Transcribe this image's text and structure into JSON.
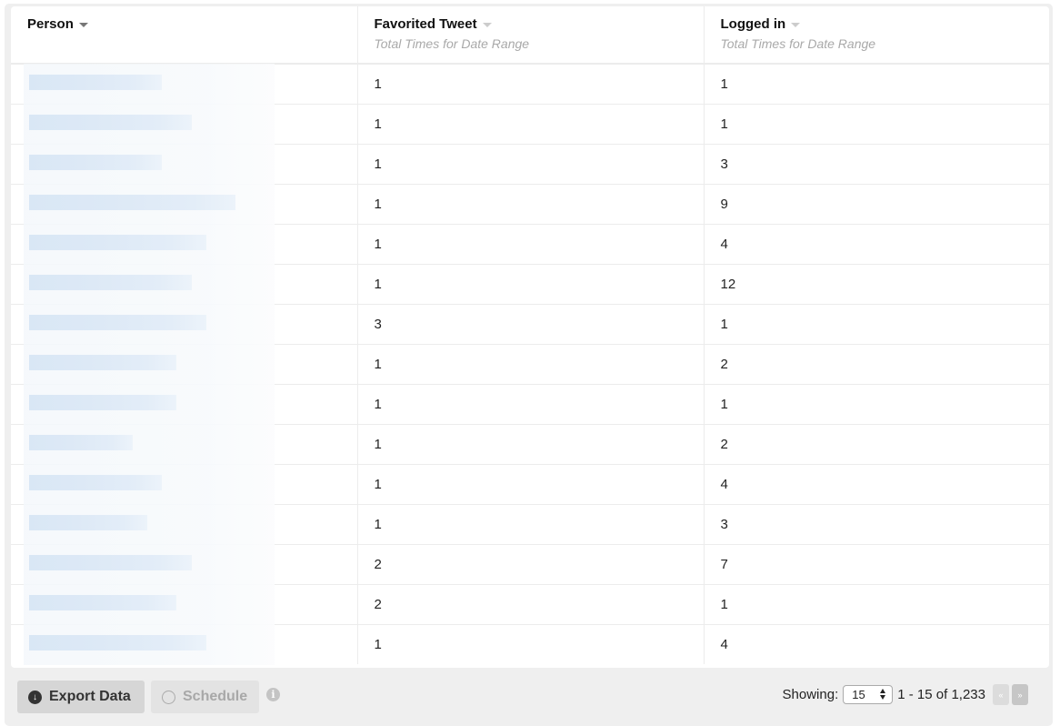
{
  "table": {
    "columns": [
      {
        "title": "Person",
        "subtitle": ""
      },
      {
        "title": "Favorited Tweet",
        "subtitle": "Total Times for Date Range"
      },
      {
        "title": "Logged in",
        "subtitle": "Total Times for Date Range"
      }
    ],
    "rows": [
      {
        "person": "",
        "favorited_tweet": "1",
        "logged_in": "1"
      },
      {
        "person": "",
        "favorited_tweet": "1",
        "logged_in": "1"
      },
      {
        "person": "",
        "favorited_tweet": "1",
        "logged_in": "3"
      },
      {
        "person": "",
        "favorited_tweet": "1",
        "logged_in": "9"
      },
      {
        "person": "",
        "favorited_tweet": "1",
        "logged_in": "4"
      },
      {
        "person": "",
        "favorited_tweet": "1",
        "logged_in": "12"
      },
      {
        "person": "",
        "favorited_tweet": "3",
        "logged_in": "1"
      },
      {
        "person": "",
        "favorited_tweet": "1",
        "logged_in": "2"
      },
      {
        "person": "",
        "favorited_tweet": "1",
        "logged_in": "1"
      },
      {
        "person": "",
        "favorited_tweet": "1",
        "logged_in": "2"
      },
      {
        "person": "",
        "favorited_tweet": "1",
        "logged_in": "4"
      },
      {
        "person": "",
        "favorited_tweet": "1",
        "logged_in": "3"
      },
      {
        "person": "",
        "favorited_tweet": "2",
        "logged_in": "7"
      },
      {
        "person": "",
        "favorited_tweet": "2",
        "logged_in": "1"
      },
      {
        "person": "",
        "favorited_tweet": "1",
        "logged_in": "4"
      }
    ]
  },
  "footer": {
    "export_label": "Export Data",
    "export_icon": "download-circle-icon",
    "schedule_label": "Schedule",
    "schedule_icon": "clock-icon",
    "info_icon": "info-circle-icon",
    "showing_label": "Showing:",
    "per_page": "15",
    "range_text": "1 - 15 of 1,233",
    "prev_label": "«",
    "next_label": "»"
  }
}
